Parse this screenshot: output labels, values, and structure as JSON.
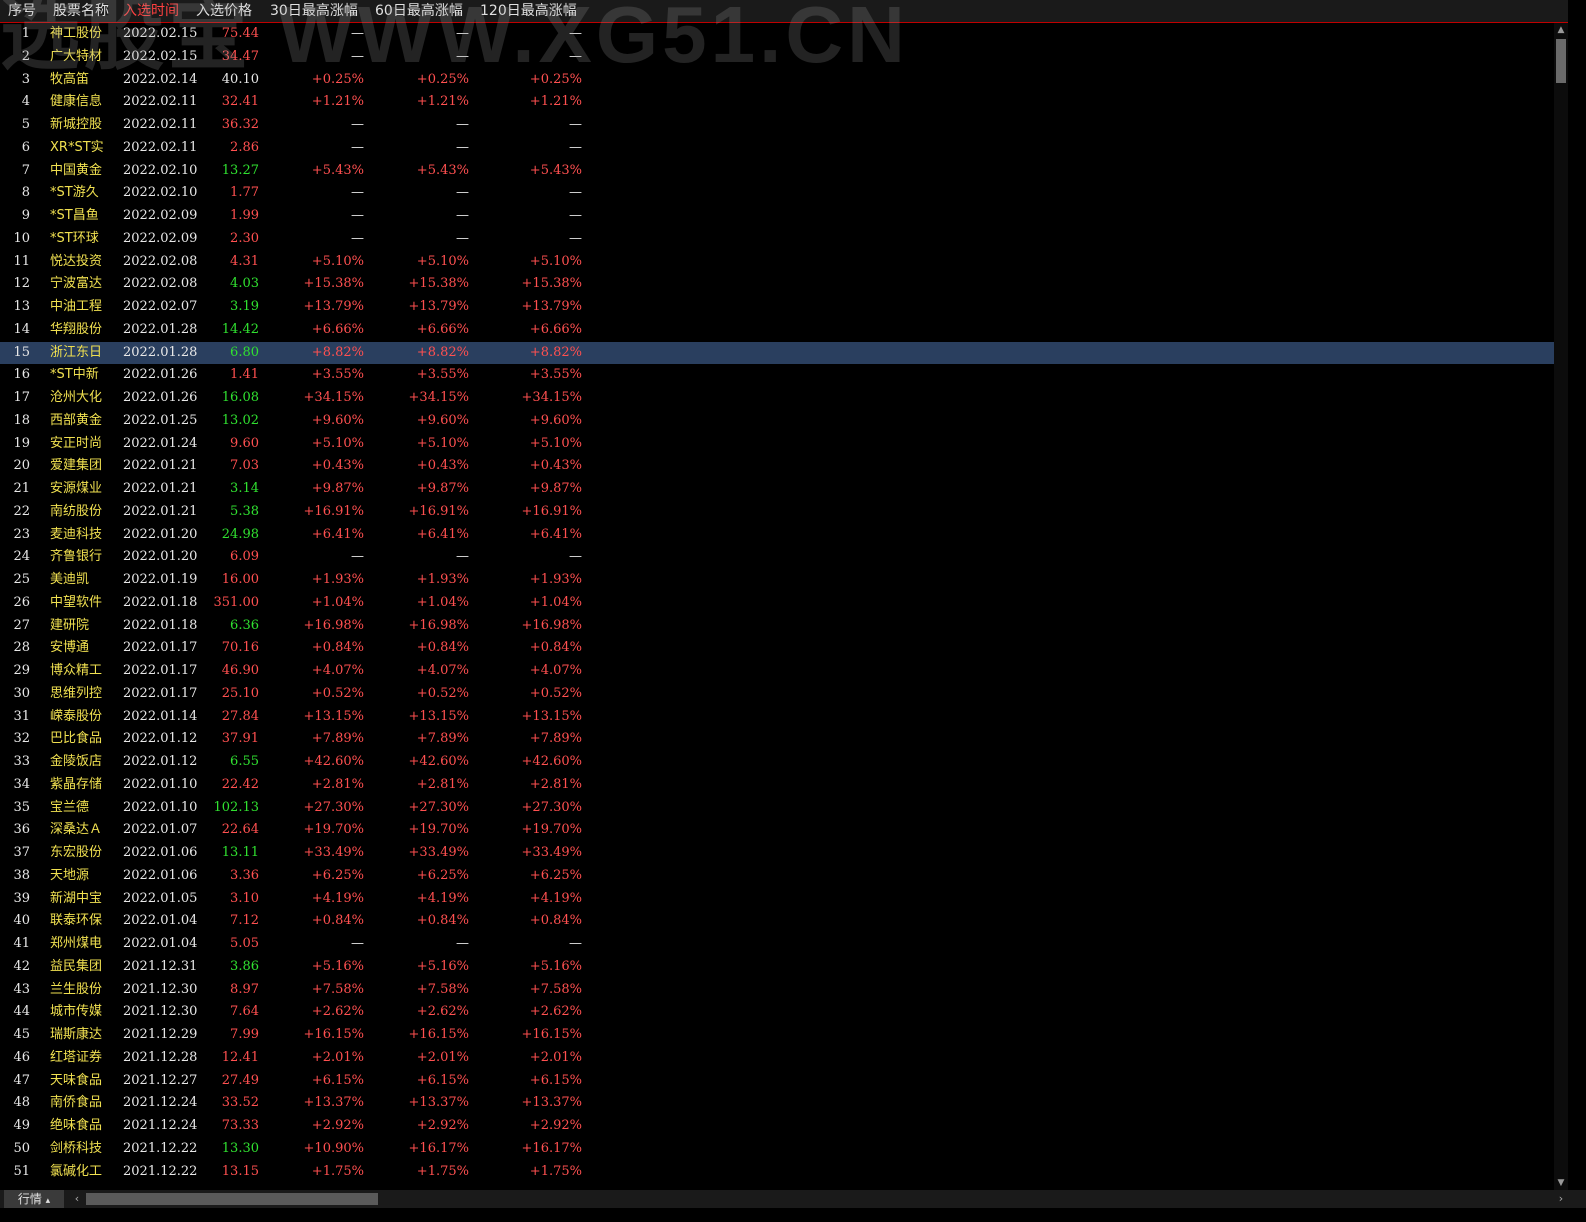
{
  "header": {
    "columns": [
      "序号",
      "股票名称",
      "入选时间",
      "入选价格",
      "30日最高涨幅",
      "60日最高涨幅",
      "120日最高涨幅"
    ],
    "active_column_index": 2
  },
  "watermark": "选股宝 WWW.XG51.CN",
  "colors": {
    "up": "#ff5050",
    "down": "#30e030",
    "neutral": "#e8e8e8",
    "name": "#f0e050",
    "selected_row": "#2a3f5f",
    "header_line": "#c00000"
  },
  "selected_row_index": 14,
  "rows": [
    {
      "no": "1",
      "name": "神工股份",
      "date": "2022.02.15",
      "price": "75.44",
      "pc": "red",
      "g30": "—",
      "g60": "—",
      "g120": "—"
    },
    {
      "no": "2",
      "name": "广大特材",
      "date": "2022.02.15",
      "price": "34.47",
      "pc": "red",
      "g30": "—",
      "g60": "—",
      "g120": "—"
    },
    {
      "no": "3",
      "name": "牧高笛",
      "date": "2022.02.14",
      "price": "40.10",
      "pc": "white",
      "g30": "+0.25%",
      "g60": "+0.25%",
      "g120": "+0.25%"
    },
    {
      "no": "4",
      "name": "健康信息",
      "date": "2022.02.11",
      "price": "32.41",
      "pc": "red",
      "g30": "+1.21%",
      "g60": "+1.21%",
      "g120": "+1.21%"
    },
    {
      "no": "5",
      "name": "新城控股",
      "date": "2022.02.11",
      "price": "36.32",
      "pc": "red",
      "g30": "—",
      "g60": "—",
      "g120": "—"
    },
    {
      "no": "6",
      "name": "XR*ST实",
      "date": "2022.02.11",
      "price": "2.86",
      "pc": "red",
      "g30": "—",
      "g60": "—",
      "g120": "—"
    },
    {
      "no": "7",
      "name": "中国黄金",
      "date": "2022.02.10",
      "price": "13.27",
      "pc": "green",
      "g30": "+5.43%",
      "g60": "+5.43%",
      "g120": "+5.43%"
    },
    {
      "no": "8",
      "name": "*ST游久",
      "date": "2022.02.10",
      "price": "1.77",
      "pc": "red",
      "g30": "—",
      "g60": "—",
      "g120": "—"
    },
    {
      "no": "9",
      "name": "*ST昌鱼",
      "date": "2022.02.09",
      "price": "1.99",
      "pc": "red",
      "g30": "—",
      "g60": "—",
      "g120": "—"
    },
    {
      "no": "10",
      "name": "*ST环球",
      "date": "2022.02.09",
      "price": "2.30",
      "pc": "red",
      "g30": "—",
      "g60": "—",
      "g120": "—"
    },
    {
      "no": "11",
      "name": "悦达投资",
      "date": "2022.02.08",
      "price": "4.31",
      "pc": "red",
      "g30": "+5.10%",
      "g60": "+5.10%",
      "g120": "+5.10%"
    },
    {
      "no": "12",
      "name": "宁波富达",
      "date": "2022.02.08",
      "price": "4.03",
      "pc": "green",
      "g30": "+15.38%",
      "g60": "+15.38%",
      "g120": "+15.38%"
    },
    {
      "no": "13",
      "name": "中油工程",
      "date": "2022.02.07",
      "price": "3.19",
      "pc": "green",
      "g30": "+13.79%",
      "g60": "+13.79%",
      "g120": "+13.79%"
    },
    {
      "no": "14",
      "name": "华翔股份",
      "date": "2022.01.28",
      "price": "14.42",
      "pc": "green",
      "g30": "+6.66%",
      "g60": "+6.66%",
      "g120": "+6.66%"
    },
    {
      "no": "15",
      "name": "浙江东日",
      "date": "2022.01.28",
      "price": "6.80",
      "pc": "green",
      "g30": "+8.82%",
      "g60": "+8.82%",
      "g120": "+8.82%"
    },
    {
      "no": "16",
      "name": "*ST中新",
      "date": "2022.01.26",
      "price": "1.41",
      "pc": "red",
      "g30": "+3.55%",
      "g60": "+3.55%",
      "g120": "+3.55%"
    },
    {
      "no": "17",
      "name": "沧州大化",
      "date": "2022.01.26",
      "price": "16.08",
      "pc": "green",
      "g30": "+34.15%",
      "g60": "+34.15%",
      "g120": "+34.15%"
    },
    {
      "no": "18",
      "name": "西部黄金",
      "date": "2022.01.25",
      "price": "13.02",
      "pc": "green",
      "g30": "+9.60%",
      "g60": "+9.60%",
      "g120": "+9.60%"
    },
    {
      "no": "19",
      "name": "安正时尚",
      "date": "2022.01.24",
      "price": "9.60",
      "pc": "red",
      "g30": "+5.10%",
      "g60": "+5.10%",
      "g120": "+5.10%"
    },
    {
      "no": "20",
      "name": "爱建集团",
      "date": "2022.01.21",
      "price": "7.03",
      "pc": "red",
      "g30": "+0.43%",
      "g60": "+0.43%",
      "g120": "+0.43%"
    },
    {
      "no": "21",
      "name": "安源煤业",
      "date": "2022.01.21",
      "price": "3.14",
      "pc": "green",
      "g30": "+9.87%",
      "g60": "+9.87%",
      "g120": "+9.87%"
    },
    {
      "no": "22",
      "name": "南纺股份",
      "date": "2022.01.21",
      "price": "5.38",
      "pc": "green",
      "g30": "+16.91%",
      "g60": "+16.91%",
      "g120": "+16.91%"
    },
    {
      "no": "23",
      "name": "麦迪科技",
      "date": "2022.01.20",
      "price": "24.98",
      "pc": "green",
      "g30": "+6.41%",
      "g60": "+6.41%",
      "g120": "+6.41%"
    },
    {
      "no": "24",
      "name": "齐鲁银行",
      "date": "2022.01.20",
      "price": "6.09",
      "pc": "red",
      "g30": "—",
      "g60": "—",
      "g120": "—"
    },
    {
      "no": "25",
      "name": "美迪凯",
      "date": "2022.01.19",
      "price": "16.00",
      "pc": "red",
      "g30": "+1.93%",
      "g60": "+1.93%",
      "g120": "+1.93%"
    },
    {
      "no": "26",
      "name": "中望软件",
      "date": "2022.01.18",
      "price": "351.00",
      "pc": "red",
      "g30": "+1.04%",
      "g60": "+1.04%",
      "g120": "+1.04%"
    },
    {
      "no": "27",
      "name": "建研院",
      "date": "2022.01.18",
      "price": "6.36",
      "pc": "green",
      "g30": "+16.98%",
      "g60": "+16.98%",
      "g120": "+16.98%"
    },
    {
      "no": "28",
      "name": "安博通",
      "date": "2022.01.17",
      "price": "70.16",
      "pc": "red",
      "g30": "+0.84%",
      "g60": "+0.84%",
      "g120": "+0.84%"
    },
    {
      "no": "29",
      "name": "博众精工",
      "date": "2022.01.17",
      "price": "46.90",
      "pc": "red",
      "g30": "+4.07%",
      "g60": "+4.07%",
      "g120": "+4.07%"
    },
    {
      "no": "30",
      "name": "思维列控",
      "date": "2022.01.17",
      "price": "25.10",
      "pc": "red",
      "g30": "+0.52%",
      "g60": "+0.52%",
      "g120": "+0.52%"
    },
    {
      "no": "31",
      "name": "嵘泰股份",
      "date": "2022.01.14",
      "price": "27.84",
      "pc": "red",
      "g30": "+13.15%",
      "g60": "+13.15%",
      "g120": "+13.15%"
    },
    {
      "no": "32",
      "name": "巴比食品",
      "date": "2022.01.12",
      "price": "37.91",
      "pc": "red",
      "g30": "+7.89%",
      "g60": "+7.89%",
      "g120": "+7.89%"
    },
    {
      "no": "33",
      "name": "金陵饭店",
      "date": "2022.01.12",
      "price": "6.55",
      "pc": "green",
      "g30": "+42.60%",
      "g60": "+42.60%",
      "g120": "+42.60%"
    },
    {
      "no": "34",
      "name": "紫晶存储",
      "date": "2022.01.10",
      "price": "22.42",
      "pc": "red",
      "g30": "+2.81%",
      "g60": "+2.81%",
      "g120": "+2.81%"
    },
    {
      "no": "35",
      "name": "宝兰德",
      "date": "2022.01.10",
      "price": "102.13",
      "pc": "green",
      "g30": "+27.30%",
      "g60": "+27.30%",
      "g120": "+27.30%"
    },
    {
      "no": "36",
      "name": "深桑达Ａ",
      "date": "2022.01.07",
      "price": "22.64",
      "pc": "red",
      "g30": "+19.70%",
      "g60": "+19.70%",
      "g120": "+19.70%"
    },
    {
      "no": "37",
      "name": "东宏股份",
      "date": "2022.01.06",
      "price": "13.11",
      "pc": "green",
      "g30": "+33.49%",
      "g60": "+33.49%",
      "g120": "+33.49%"
    },
    {
      "no": "38",
      "name": "天地源",
      "date": "2022.01.06",
      "price": "3.36",
      "pc": "red",
      "g30": "+6.25%",
      "g60": "+6.25%",
      "g120": "+6.25%"
    },
    {
      "no": "39",
      "name": "新湖中宝",
      "date": "2022.01.05",
      "price": "3.10",
      "pc": "red",
      "g30": "+4.19%",
      "g60": "+4.19%",
      "g120": "+4.19%"
    },
    {
      "no": "40",
      "name": "联泰环保",
      "date": "2022.01.04",
      "price": "7.12",
      "pc": "red",
      "g30": "+0.84%",
      "g60": "+0.84%",
      "g120": "+0.84%"
    },
    {
      "no": "41",
      "name": "郑州煤电",
      "date": "2022.01.04",
      "price": "5.05",
      "pc": "red",
      "g30": "—",
      "g60": "—",
      "g120": "—"
    },
    {
      "no": "42",
      "name": "益民集团",
      "date": "2021.12.31",
      "price": "3.86",
      "pc": "green",
      "g30": "+5.16%",
      "g60": "+5.16%",
      "g120": "+5.16%"
    },
    {
      "no": "43",
      "name": "兰生股份",
      "date": "2021.12.30",
      "price": "8.97",
      "pc": "red",
      "g30": "+7.58%",
      "g60": "+7.58%",
      "g120": "+7.58%"
    },
    {
      "no": "44",
      "name": "城市传媒",
      "date": "2021.12.30",
      "price": "7.64",
      "pc": "red",
      "g30": "+2.62%",
      "g60": "+2.62%",
      "g120": "+2.62%"
    },
    {
      "no": "45",
      "name": "瑞斯康达",
      "date": "2021.12.29",
      "price": "7.99",
      "pc": "red",
      "g30": "+16.15%",
      "g60": "+16.15%",
      "g120": "+16.15%"
    },
    {
      "no": "46",
      "name": "红塔证券",
      "date": "2021.12.28",
      "price": "12.41",
      "pc": "red",
      "g30": "+2.01%",
      "g60": "+2.01%",
      "g120": "+2.01%"
    },
    {
      "no": "47",
      "name": "天味食品",
      "date": "2021.12.27",
      "price": "27.49",
      "pc": "red",
      "g30": "+6.15%",
      "g60": "+6.15%",
      "g120": "+6.15%"
    },
    {
      "no": "48",
      "name": "南侨食品",
      "date": "2021.12.24",
      "price": "33.52",
      "pc": "red",
      "g30": "+13.37%",
      "g60": "+13.37%",
      "g120": "+13.37%"
    },
    {
      "no": "49",
      "name": "绝味食品",
      "date": "2021.12.24",
      "price": "73.33",
      "pc": "red",
      "g30": "+2.92%",
      "g60": "+2.92%",
      "g120": "+2.92%"
    },
    {
      "no": "50",
      "name": "剑桥科技",
      "date": "2021.12.22",
      "price": "13.30",
      "pc": "green",
      "g30": "+10.90%",
      "g60": "+16.17%",
      "g120": "+16.17%"
    },
    {
      "no": "51",
      "name": "氯碱化工",
      "date": "2021.12.22",
      "price": "13.15",
      "pc": "red",
      "g30": "+1.75%",
      "g60": "+1.75%",
      "g120": "+1.75%"
    }
  ],
  "bottom": {
    "tab_label": "行情",
    "tab_arrow": "▴"
  },
  "icons": {
    "scroll_up": "scroll-up-arrow-icon",
    "scroll_down": "scroll-down-arrow-icon",
    "scroll_left": "scroll-left-arrow-icon",
    "scroll_right": "scroll-right-arrow-icon"
  }
}
